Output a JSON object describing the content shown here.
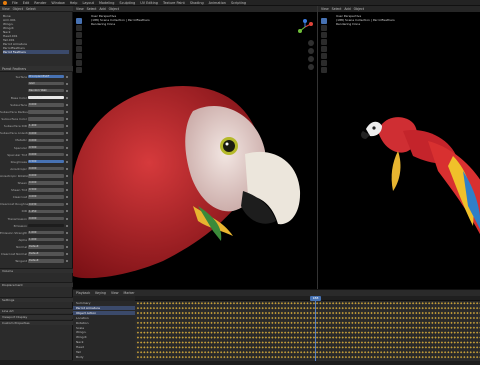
{
  "menu": [
    "File",
    "Edit",
    "Render",
    "Window",
    "Help",
    "Layout",
    "Modeling",
    "Sculpting",
    "UV Editing",
    "Texture Paint",
    "Shading",
    "Animation",
    "Scripting"
  ],
  "left_panel": {
    "header": [
      "View",
      "Object",
      "Select"
    ],
    "outliner_items": [
      "Bone",
      "Arm.001",
      "Wing.L",
      "Wing.R",
      "Neck",
      "Head.001",
      "Tail.001",
      "Parrot Armature",
      "ParrotFeathers",
      "Parrot Feathers"
    ],
    "props_header": [
      "Parrot Feathers"
    ],
    "props": [
      {
        "label": "Surface",
        "value": "Principled BSDF"
      },
      {
        "label": "",
        "value": "GGX"
      },
      {
        "label": "",
        "value": "Random Walk"
      },
      {
        "label": "Base Color",
        "value": "Parrot_Diff"
      },
      {
        "label": "Subsurface",
        "value": "0.000"
      },
      {
        "label": "Subsurface Radius",
        "value": ""
      },
      {
        "label": "Subsurface Color",
        "value": ""
      },
      {
        "label": "Subsurface IOR",
        "value": "1.400"
      },
      {
        "label": "Subsurface Anisotropy",
        "value": "0.000"
      },
      {
        "label": "Metallic",
        "value": "0.000"
      },
      {
        "label": "Specular",
        "value": "0.500"
      },
      {
        "label": "Specular Tint",
        "value": "0.000"
      },
      {
        "label": "Roughness",
        "value": "0.500"
      },
      {
        "label": "Anisotropic",
        "value": "0.000"
      },
      {
        "label": "Anisotropic Rotation",
        "value": "0.000"
      },
      {
        "label": "Sheen",
        "value": "0.000"
      },
      {
        "label": "Sheen Tint",
        "value": "0.500"
      },
      {
        "label": "Clearcoat",
        "value": "0.000"
      },
      {
        "label": "Clearcoat Roughness",
        "value": "0.030"
      },
      {
        "label": "IOR",
        "value": "1.450"
      },
      {
        "label": "Transmission",
        "value": "0.000"
      },
      {
        "label": "Emission",
        "value": ""
      },
      {
        "label": "Emission Strength",
        "value": "1.000"
      },
      {
        "label": "Alpha",
        "value": "1.000"
      },
      {
        "label": "Normal",
        "value": "Default"
      },
      {
        "label": "Clearcoat Normal",
        "value": "Default"
      },
      {
        "label": "Tangent",
        "value": "Default"
      }
    ],
    "sections": [
      "Volume",
      "Displacement",
      "Settings",
      "Line Art",
      "Viewport Display",
      "Custom Properties"
    ]
  },
  "viewport_left": {
    "header": [
      "View",
      "Select",
      "Add",
      "Object"
    ],
    "info": [
      "User Perspective",
      "(188) Scene Collection | ParrotFeathers",
      "Rendering Done"
    ]
  },
  "viewport_right": {
    "header": [
      "View",
      "Select",
      "Add",
      "Object"
    ],
    "info": [
      "User Perspective",
      "(188) Scene Collection | ParrotFeathers",
      "Rendering Done"
    ]
  },
  "timeline": {
    "header": [
      "Playback",
      "Keying",
      "View",
      "Marker"
    ],
    "current_frame": "188",
    "rows": [
      "Summary",
      "Parrot Armature",
      "Object Action",
      "Location",
      "Rotation",
      "Scale",
      "Wing.L",
      "Wing.R",
      "Neck",
      "Head",
      "Tail",
      "Body"
    ]
  },
  "colors": {
    "accent": "#4772b3",
    "keyframe": "#c9a13a",
    "parrot_red": "#c8242b",
    "wing_yellow": "#f0c02a"
  }
}
